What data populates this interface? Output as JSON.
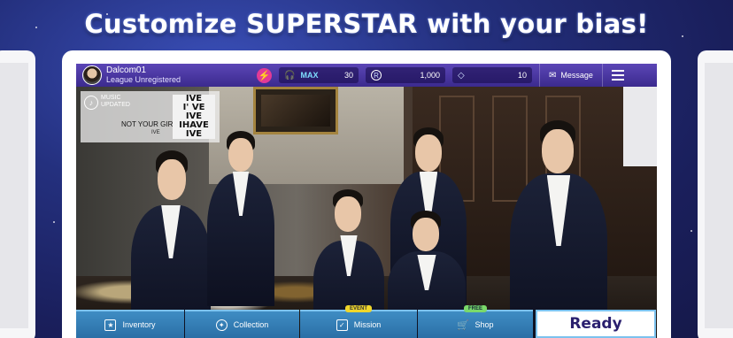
{
  "headline": "Customize SUPERSTAR with your bias!",
  "topbar": {
    "username": "Dalcom01",
    "league": "League Unregistered",
    "headphones": {
      "icon": "headphones-icon",
      "label": "MAX",
      "value": "30"
    },
    "ruby": {
      "icon": "r-coin-icon",
      "symbol": "R",
      "value": "1,000"
    },
    "diamond": {
      "icon": "diamond-icon",
      "value": "10"
    },
    "message_label": "Message"
  },
  "music_card": {
    "status": "MUSIC UPDATED",
    "title": "NOT YOUR GIRL",
    "artist": "IVE",
    "cover_lines": [
      "IVE",
      "I' VE",
      "IVE",
      "IHAVE",
      "IVE"
    ]
  },
  "bottombar": {
    "inventory": "Inventory",
    "collection": "Collection",
    "mission": "Mission",
    "mission_badge": "EVENT",
    "shop": "Shop",
    "shop_badge": "FREE",
    "ready": "Ready"
  },
  "colors": {
    "topbar": "#4a38a4",
    "tabs": "#2f7db5",
    "accent_pink": "#e23a96"
  }
}
